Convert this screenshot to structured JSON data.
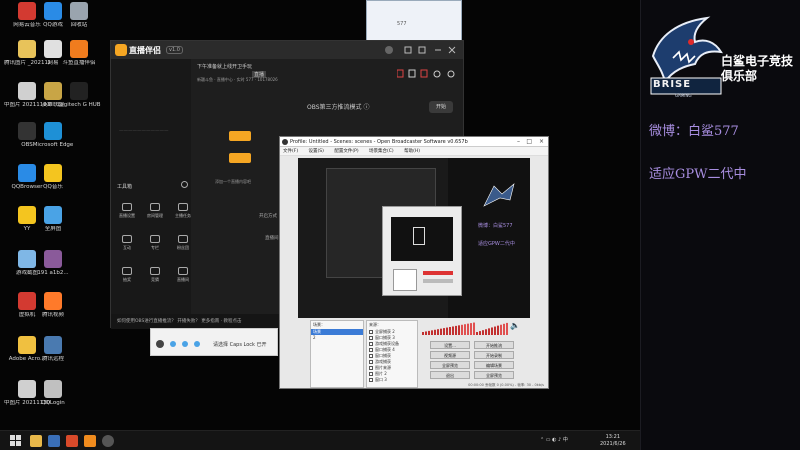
{
  "desktop_icons": [
    {
      "label": "网易云音乐",
      "color": "#d33a31"
    },
    {
      "label": "QQ游戏",
      "color": "#2a8be6"
    },
    {
      "label": "回收站",
      "color": "#9aa4ae"
    },
    {
      "label": "腾讯图片 _2021121...",
      "color": "#e8c35a"
    },
    {
      "label": "网易",
      "color": "#e0e0e0"
    },
    {
      "label": "斗鱼直播伴侣",
      "color": "#f07c1e"
    },
    {
      "label": "中图片 20211123...",
      "color": "#d0d0d0"
    },
    {
      "label": "英雄联盟",
      "color": "#c8a546"
    },
    {
      "label": "Logitech G HUB",
      "color": "#222"
    },
    {
      "label": "OBS",
      "color": "#333"
    },
    {
      "label": "Microsoft Edge",
      "color": "#1e90d6"
    },
    {
      "label": "QQBrowser",
      "color": "#2a8be6"
    },
    {
      "label": "QQ音乐",
      "color": "#f4c51f"
    },
    {
      "label": "YY",
      "color": "#f4c51f"
    },
    {
      "label": "全屏图",
      "color": "#4aa3e6"
    },
    {
      "label": "游戏截图",
      "color": "#7fb7e6"
    },
    {
      "label": "191 a1b2...",
      "color": "#8a5a9a"
    },
    {
      "label": "虚拟机",
      "color": "#d33a31"
    },
    {
      "label": "腾讯视频",
      "color": "#ff7a2a"
    },
    {
      "label": "Adobe Acro...",
      "color": "#f0c040"
    },
    {
      "label": "腾讯远程",
      "color": "#4a7ab0"
    },
    {
      "label": "中图片 20211130...",
      "color": "#d0d0d0"
    },
    {
      "label": "QQLogin",
      "color": "#c0c0c0"
    }
  ],
  "brand": {
    "logo_text": "BRISE",
    "logo_sub": "GAMING",
    "club_line1": "白鲨电子竞技",
    "club_line2": "俱乐部",
    "weibo": "微博：白鲨577",
    "adapt": "适应GPW二代中",
    "accent": "#a88ee0"
  },
  "qq_window": {
    "title": "577"
  },
  "live_assistant": {
    "title": "直播伴侣",
    "version": "v1.0",
    "top_text": "下午准备就上线开卫手玩",
    "top_btn": "直播",
    "sub_text": "新疆斗鱼 · 直播中心 · 实时 577 · 10178026",
    "obs_mode": "OBS第三方推流模式 ⓘ",
    "start_label": "开始",
    "tools_title": "工具箱",
    "tools": [
      "直播设置",
      "房间管理",
      "主播任务",
      "互动",
      "专栏",
      "粉丝团",
      "抽奖",
      "竞猜",
      "直播间"
    ],
    "scene_hint": "添加一个直播内容吧",
    "right_hint1": "开启方式",
    "right_hint2": "直播间",
    "footer": "如何使用OBS进行直播推流？  开播失败？  更多指南 · 教程点击"
  },
  "light_bar": {
    "text": "请选择 Caps Lock 已开"
  },
  "obs": {
    "title": "Profile: Untitled - Scenes: scenes - Open Broadcaster Software v0.657b",
    "menu": [
      "文件(F)",
      "设置(S)",
      "配置文件(P)",
      "场景集合(C)",
      "帮助(H)"
    ],
    "scenes_header": "场景：",
    "scenes": [
      "场景",
      "2"
    ],
    "sources_header": "来源：",
    "sources": [
      "全屏捕获 2",
      "窗口捕获 3",
      "游戏捕获设备",
      "窗口捕获 4",
      "窗口捕获",
      "游戏捕获",
      "图片来源",
      "图片 2",
      "窗口 3"
    ],
    "buttons": [
      "设置...",
      "开始推流",
      "视频源",
      "开始录制",
      "全屏预览",
      "编辑场景",
      "退出",
      "全屏预览"
    ],
    "status": "00:00:00 丢帧数 0 (0.00%) - 帧率: 30 - 0kb/s"
  },
  "taskbar": {
    "time": "13:21",
    "date": "2021/6/26",
    "apps": [
      "windows-start",
      "file-explorer",
      "calculator",
      "chat",
      "music",
      "obs"
    ]
  }
}
